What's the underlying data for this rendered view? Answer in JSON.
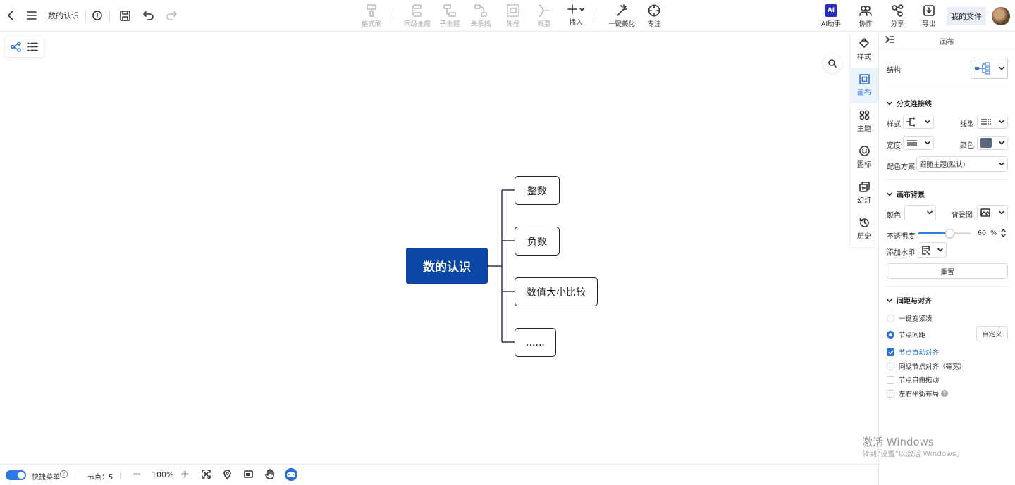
{
  "topbar": {
    "doc_title": "数的认识",
    "tools": [
      {
        "label": "格式刷",
        "icon": "format-painter-icon",
        "enabled": false
      },
      {
        "label": "同级主题",
        "icon": "sibling-topic-icon",
        "enabled": false
      },
      {
        "label": "子主题",
        "icon": "child-topic-icon",
        "enabled": false
      },
      {
        "label": "关系线",
        "icon": "relation-line-icon",
        "enabled": false
      },
      {
        "label": "外框",
        "icon": "boundary-icon",
        "enabled": false
      },
      {
        "label": "概要",
        "icon": "summary-icon",
        "enabled": false
      },
      {
        "label": "插入",
        "icon": "plus-icon",
        "enabled": true
      },
      {
        "label": "一键美化",
        "icon": "magic-wand-icon",
        "enabled": true
      },
      {
        "label": "专注",
        "icon": "focus-icon",
        "enabled": true
      }
    ],
    "right": {
      "ai_label": "AI助手",
      "ai_badge": "AI",
      "collab_label": "协作",
      "share_label": "分享",
      "export_label": "导出",
      "myfiles_label": "我的文件"
    }
  },
  "mindmap": {
    "root": "数的认识",
    "children": [
      "整数",
      "负数",
      "数值大小比较",
      "......"
    ]
  },
  "side_tabs": [
    {
      "label": "样式",
      "icon": "style-icon",
      "active": false
    },
    {
      "label": "画布",
      "icon": "canvas-icon",
      "active": true
    },
    {
      "label": "主题",
      "icon": "theme-icon",
      "active": false
    },
    {
      "label": "图标",
      "icon": "emoji-icon",
      "active": false
    },
    {
      "label": "幻灯",
      "icon": "slides-icon",
      "active": false
    },
    {
      "label": "历史",
      "icon": "history-icon",
      "active": false
    }
  ],
  "panel": {
    "title": "画布",
    "structure_label": "结构",
    "branch_section": "分支连接线",
    "style_label": "样式",
    "linetype_label": "线型",
    "width_label": "宽度",
    "color_label": "颜色",
    "branch_color": "#5a6880",
    "scheme_label": "配色方案",
    "scheme_value": "跟随主题(默认)",
    "bg_section": "画布背景",
    "bg_color_label": "颜色",
    "bg_image_label": "背景图",
    "opacity_label": "不透明度",
    "opacity_value": "60",
    "opacity_unit": "%",
    "watermark_label": "添加水印",
    "reset_label": "重置",
    "spacing_section": "间距与对齐",
    "compact_label": "一键变紧凑",
    "node_spacing_label": "节点间距",
    "custom_label": "自定义",
    "auto_align_label": "节点自动对齐",
    "sibling_align_label": "同级节点对齐（等宽）",
    "free_drag_label": "节点自由拖动",
    "balance_label": "左右平衡布局"
  },
  "bottombar": {
    "quick_menu_label": "快捷菜单",
    "node_count_label": "节点：5",
    "zoom": "100%"
  },
  "os_watermark": {
    "line1": "激活 Windows",
    "line2": "转到\"设置\"以激活 Windows。"
  },
  "colors": {
    "root_fill": "#0a47a5",
    "accent": "#2c6fd1"
  }
}
